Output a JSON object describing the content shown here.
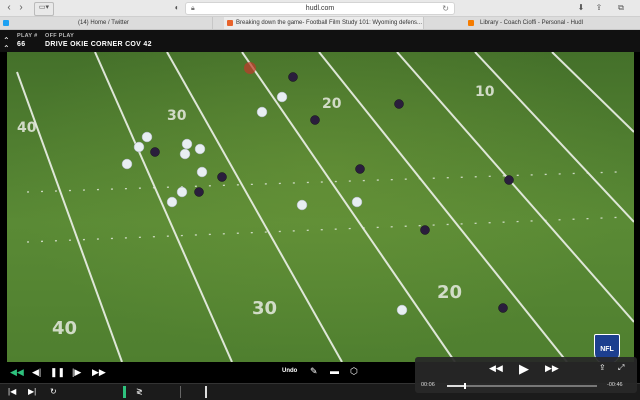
{
  "browser": {
    "url": "hudl.com",
    "tabs": [
      {
        "label": "(14) Home / Twitter",
        "favicon_color": "#1da1f2",
        "active": false
      },
      {
        "label": "Breaking down the game- Football Film Study 101: Wyoming defens...",
        "favicon_color": "#e8632b",
        "active": true
      },
      {
        "label": "Library - Coach Cioffi - Personal - Hudl",
        "favicon_color": "#f57c00",
        "active": false
      }
    ]
  },
  "header": {
    "play_label": "PLAY #",
    "play_number": "66",
    "off_play_label": "OFF PLAY",
    "off_play_value": "DRIVE OKIE CORNER COV 42"
  },
  "field": {
    "yard_numbers": [
      "40",
      "30",
      "20",
      "10",
      "40",
      "30",
      "20"
    ],
    "field_color": "#4d7a2f",
    "line_color": "#f0f0f0",
    "offense_jersey": "#e8eef2",
    "defense_jersey": "#2a1e3c",
    "logo_text": "NFL"
  },
  "controls": {
    "undo_label": "Undo"
  },
  "mini_player": {
    "current_time": "00:06",
    "remaining_time": "-00:46",
    "progress": 0.12
  },
  "colors": {
    "accent_green": "#2ec27e",
    "header_bg": "#111111"
  }
}
